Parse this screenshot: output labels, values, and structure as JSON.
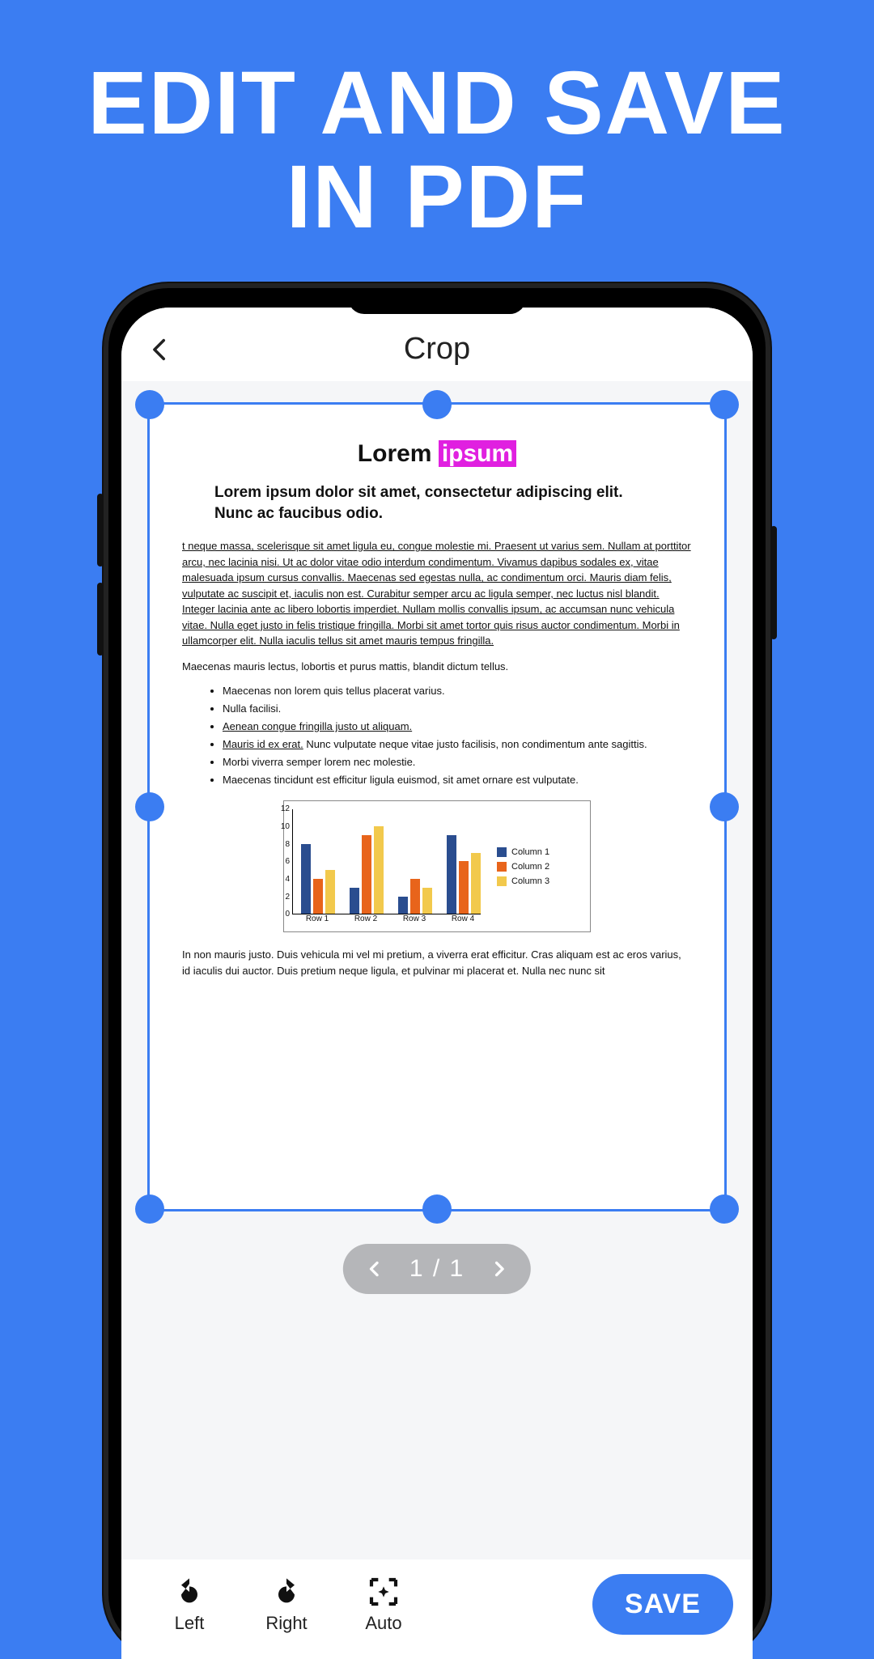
{
  "promo": {
    "line1": "EDIT AND SAVE",
    "line2": "IN PDF"
  },
  "header": {
    "title": "Crop"
  },
  "document": {
    "title_plain": "Lorem ",
    "title_highlight": "ipsum",
    "subheading": "Lorem ipsum dolor sit amet, consectetur adipiscing elit. Nunc ac faucibus odio.",
    "paragraph": "t neque massa, scelerisque sit amet ligula eu, congue molestie mi. Praesent ut varius sem. Nullam at porttitor arcu, nec lacinia nisi. Ut ac dolor vitae odio interdum condimentum. Vivamus dapibus sodales ex, vitae malesuada ipsum cursus convallis. Maecenas sed egestas nulla, ac condimentum orci. Mauris diam felis, vulputate ac suscipit et, iaculis non est. Curabitur semper arcu ac ligula semper, nec luctus nisl blandit. Integer lacinia ante ac libero lobortis imperdiet. Nullam mollis convallis ipsum, ac accumsan nunc vehicula vitae. Nulla eget justo in felis tristique fringilla. Morbi sit amet tortor quis risus auctor condimentum. Morbi in ullamcorper elit. Nulla iaculis tellus sit amet mauris tempus fringilla.",
    "line_after": "Maecenas mauris lectus, lobortis et purus mattis, blandit dictum tellus.",
    "bullets": [
      {
        "text": "Maecenas non lorem quis tellus placerat varius.",
        "underline": false
      },
      {
        "text": "Nulla facilisi.",
        "underline": false
      },
      {
        "text": "Aenean congue fringilla justo ut aliquam.",
        "underline": true
      },
      {
        "text_prefix_u": "Mauris id ex erat.",
        "text_rest": " Nunc vulputate neque vitae justo facilisis, non condimentum ante sagittis."
      },
      {
        "text": "Morbi viverra semper lorem nec molestie.",
        "underline": false
      },
      {
        "text": "Maecenas tincidunt est efficitur ligula euismod, sit amet ornare est vulputate.",
        "underline": false
      }
    ],
    "footer": "In non mauris justo. Duis vehicula mi vel mi pretium, a viverra erat efficitur. Cras aliquam est ac eros varius, id iaculis dui auctor. Duis pretium neque ligula, et pulvinar mi placerat et. Nulla nec nunc sit"
  },
  "chart_data": {
    "type": "bar",
    "categories": [
      "Row 1",
      "Row 2",
      "Row 3",
      "Row 4"
    ],
    "series": [
      {
        "name": "Column 1",
        "values": [
          8,
          3,
          2,
          9
        ],
        "color": "#2A4D8F"
      },
      {
        "name": "Column 2",
        "values": [
          4,
          9,
          4,
          6
        ],
        "color": "#E8641B"
      },
      {
        "name": "Column 3",
        "values": [
          5,
          10,
          3,
          7
        ],
        "color": "#F2C94C"
      }
    ],
    "ylim": [
      0,
      12
    ],
    "yticks": [
      0,
      2,
      4,
      6,
      8,
      10,
      12
    ],
    "xlabel": "",
    "ylabel": ""
  },
  "pager": {
    "text": "1 / 1"
  },
  "toolbar": {
    "left": "Left",
    "right": "Right",
    "auto": "Auto",
    "save": "SAVE"
  },
  "colors": {
    "accent": "#3B7DF2",
    "highlight": "#E020E0"
  }
}
